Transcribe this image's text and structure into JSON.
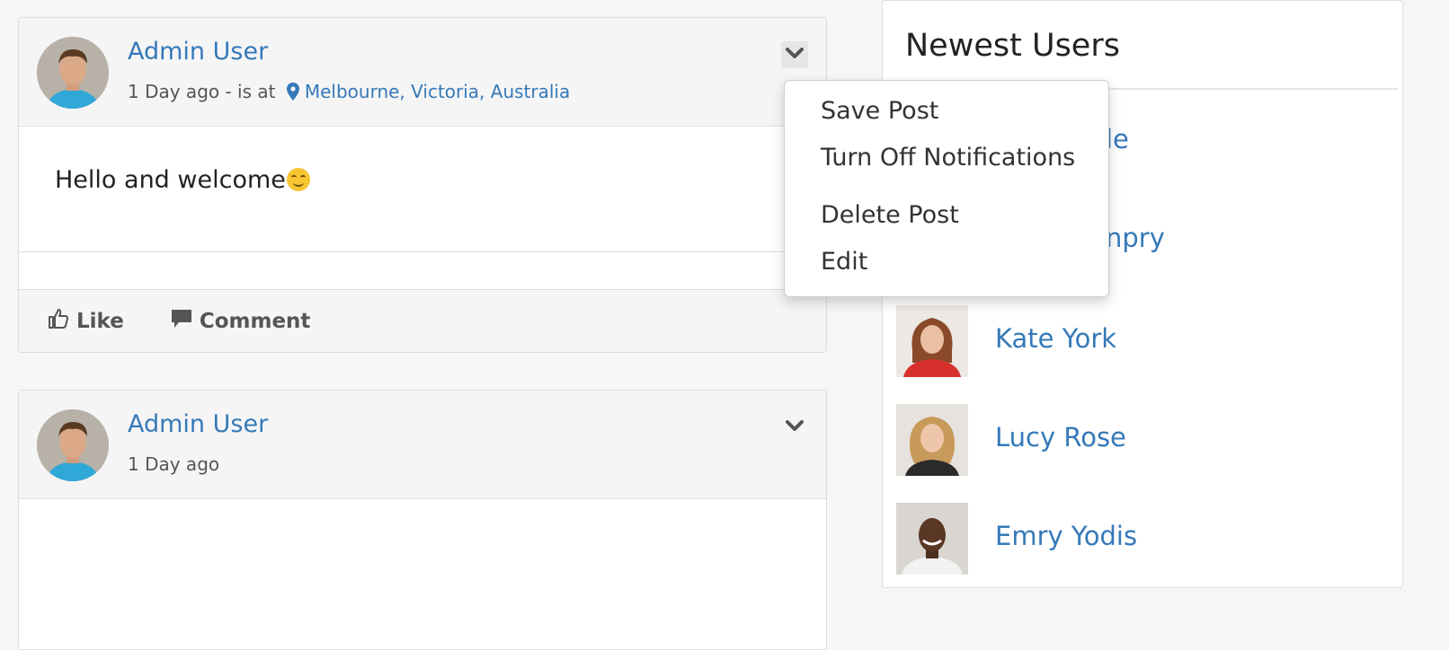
{
  "posts": [
    {
      "author": "Admin User",
      "time": "1 Day ago",
      "location_prefix": " - is at ",
      "location": "Melbourne, Victoria, Australia",
      "body": "Hello and welcome",
      "actions": {
        "like": "Like",
        "comment": "Comment"
      }
    },
    {
      "author": "Admin User",
      "time": "1 Day ago"
    }
  ],
  "dropdown": {
    "items": [
      "Save Post",
      "Turn Off Notifications",
      "Delete Post",
      "Edit"
    ]
  },
  "sidebar": {
    "title": "Newest Users",
    "users": [
      {
        "name_visible": "le"
      },
      {
        "name_visible": "npry"
      },
      {
        "name": "Kate York"
      },
      {
        "name": "Lucy Rose"
      },
      {
        "name": "Emry Yodis"
      }
    ]
  },
  "colors": {
    "link": "#3579b8",
    "header_bg": "#f5f5f5",
    "page_bg": "#f6f6f6"
  },
  "icons": [
    "chevron-down-icon",
    "map-pin-icon",
    "thumbs-up-icon",
    "comment-icon",
    "smiley-emoji-icon"
  ]
}
